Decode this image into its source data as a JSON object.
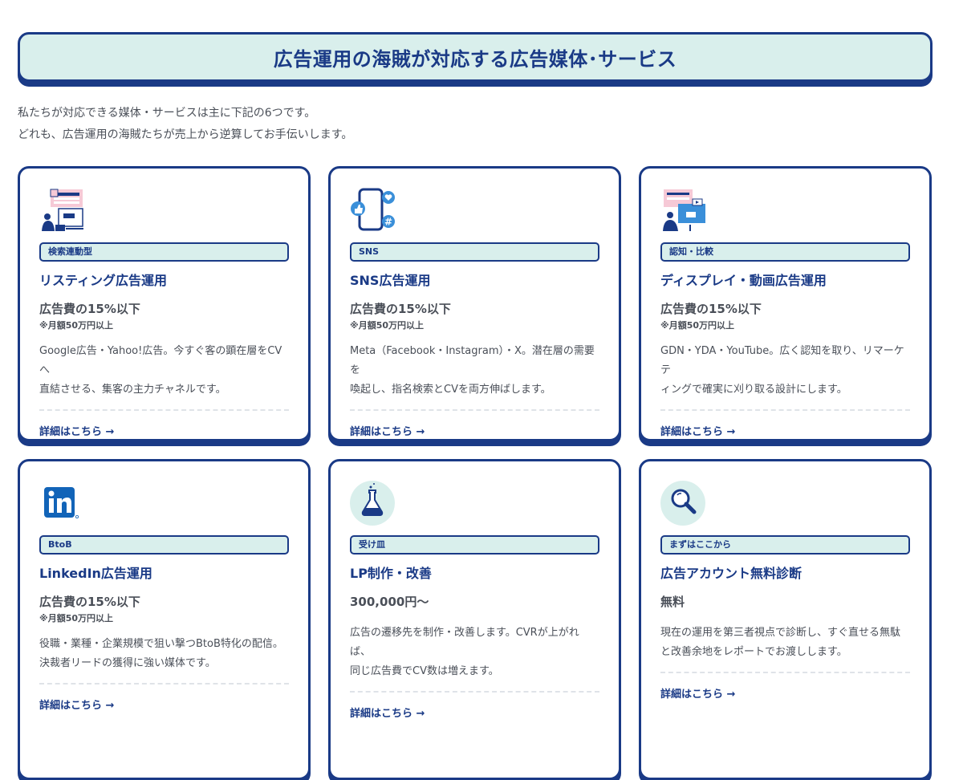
{
  "title": "広告運用の海賊が対応する広告媒体･サービス",
  "intro": [
    "私たちが対応できる媒体・サービスは主に下記の6つです。",
    "どれも、広告運用の海賊たちが売上から逆算してお手伝いします。"
  ],
  "cards": [
    {
      "icon": "listing-ad-icon",
      "badge": "検索連動型",
      "name": "リスティング広告運用",
      "price": "広告費の15%以下",
      "note": "※月額50万円以上",
      "desc": [
        "Google広告・Yahoo!広告。今すぐ客の顕在層をCVへ",
        "直結させる、集客の主力チャネルです。"
      ],
      "more": "詳細はこちら →"
    },
    {
      "icon": "sns-icon",
      "badge": "SNS",
      "name": "SNS広告運用",
      "price": "広告費の15%以下",
      "note": "※月額50万円以上",
      "desc": [
        "Meta（Facebook・Instagram）・X。潜在層の需要を",
        "喚起し、指名検索とCVを両方伸ばします。"
      ],
      "more": "詳細はこちら →"
    },
    {
      "icon": "display-video-icon",
      "badge": "認知・比較",
      "name": "ディスプレイ・動画広告運用",
      "price": "広告費の15%以下",
      "note": "※月額50万円以上",
      "desc": [
        "GDN・YDA・YouTube。広く認知を取り、リマーケテ",
        "ィングで確実に刈り取る設計にします。"
      ],
      "more": "詳細はこちら →"
    },
    {
      "icon": "linkedin-icon",
      "badge": "BtoB",
      "name": "LinkedIn広告運用",
      "price": "広告費の15%以下",
      "note": "※月額50万円以上",
      "desc": [
        "役職・業種・企業規模で狙い撃つBtoB特化の配信。",
        "決裁者リードの獲得に強い媒体です。"
      ],
      "more": "詳細はこちら →"
    },
    {
      "icon": "flask-icon",
      "badge": "受け皿",
      "name": "LP制作・改善",
      "price": "300,000円〜",
      "note": "",
      "desc": [
        "広告の遷移先を制作・改善します。CVRが上がれば、",
        "同じ広告費でCV数は増えます。"
      ],
      "more": "詳細はこちら →"
    },
    {
      "icon": "magnifier-icon",
      "badge": "まずはここから",
      "name": "広告アカウント無料診断",
      "price": "無料",
      "note": "",
      "desc": [
        "現在の運用を第三者視点で診断し、すぐ直せる無駄",
        "と改善余地をレポートでお渡しします。"
      ],
      "more": "詳細はこちら →"
    }
  ]
}
